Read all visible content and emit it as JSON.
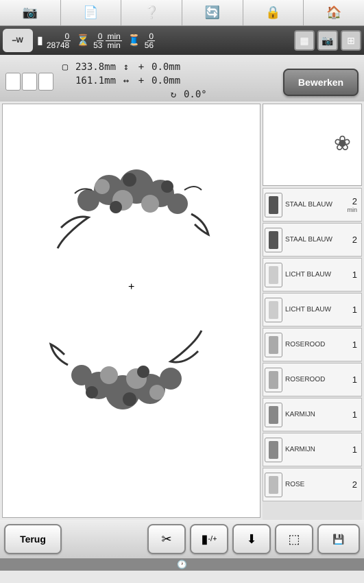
{
  "top_tabs": [
    "camera",
    "document",
    "help",
    "sync",
    "lock",
    "home"
  ],
  "status": {
    "badge": "W",
    "stitches": {
      "top": "0",
      "bot": "28748"
    },
    "time": {
      "top": "0",
      "bot": "53",
      "unit": "min"
    },
    "colors": {
      "top": "0",
      "bot": "56"
    }
  },
  "measure": {
    "height": "233.8mm",
    "width": "161.1mm",
    "off_y": "0.0mm",
    "off_x": "0.0mm",
    "rotation": "0.0°",
    "edit_label": "Bewerken"
  },
  "threads": [
    {
      "name": "STAAL BLAUW",
      "val": "2",
      "unit": "min",
      "color": "#555"
    },
    {
      "name": "STAAL BLAUW",
      "val": "2",
      "unit": "",
      "color": "#555"
    },
    {
      "name": "LICHT BLAUW",
      "val": "1",
      "unit": "",
      "color": "#ccc"
    },
    {
      "name": "LICHT BLAUW",
      "val": "1",
      "unit": "",
      "color": "#ccc"
    },
    {
      "name": "ROSEROOD",
      "val": "1",
      "unit": "",
      "color": "#aaa"
    },
    {
      "name": "ROSEROOD",
      "val": "1",
      "unit": "",
      "color": "#aaa"
    },
    {
      "name": "KARMIJN",
      "val": "1",
      "unit": "",
      "color": "#888"
    },
    {
      "name": "KARMIJN",
      "val": "1",
      "unit": "",
      "color": "#888"
    },
    {
      "name": "ROSE",
      "val": "2",
      "unit": "",
      "color": "#bbb"
    }
  ],
  "bottom": {
    "back": "Terug",
    "needle_label": "-/+"
  }
}
